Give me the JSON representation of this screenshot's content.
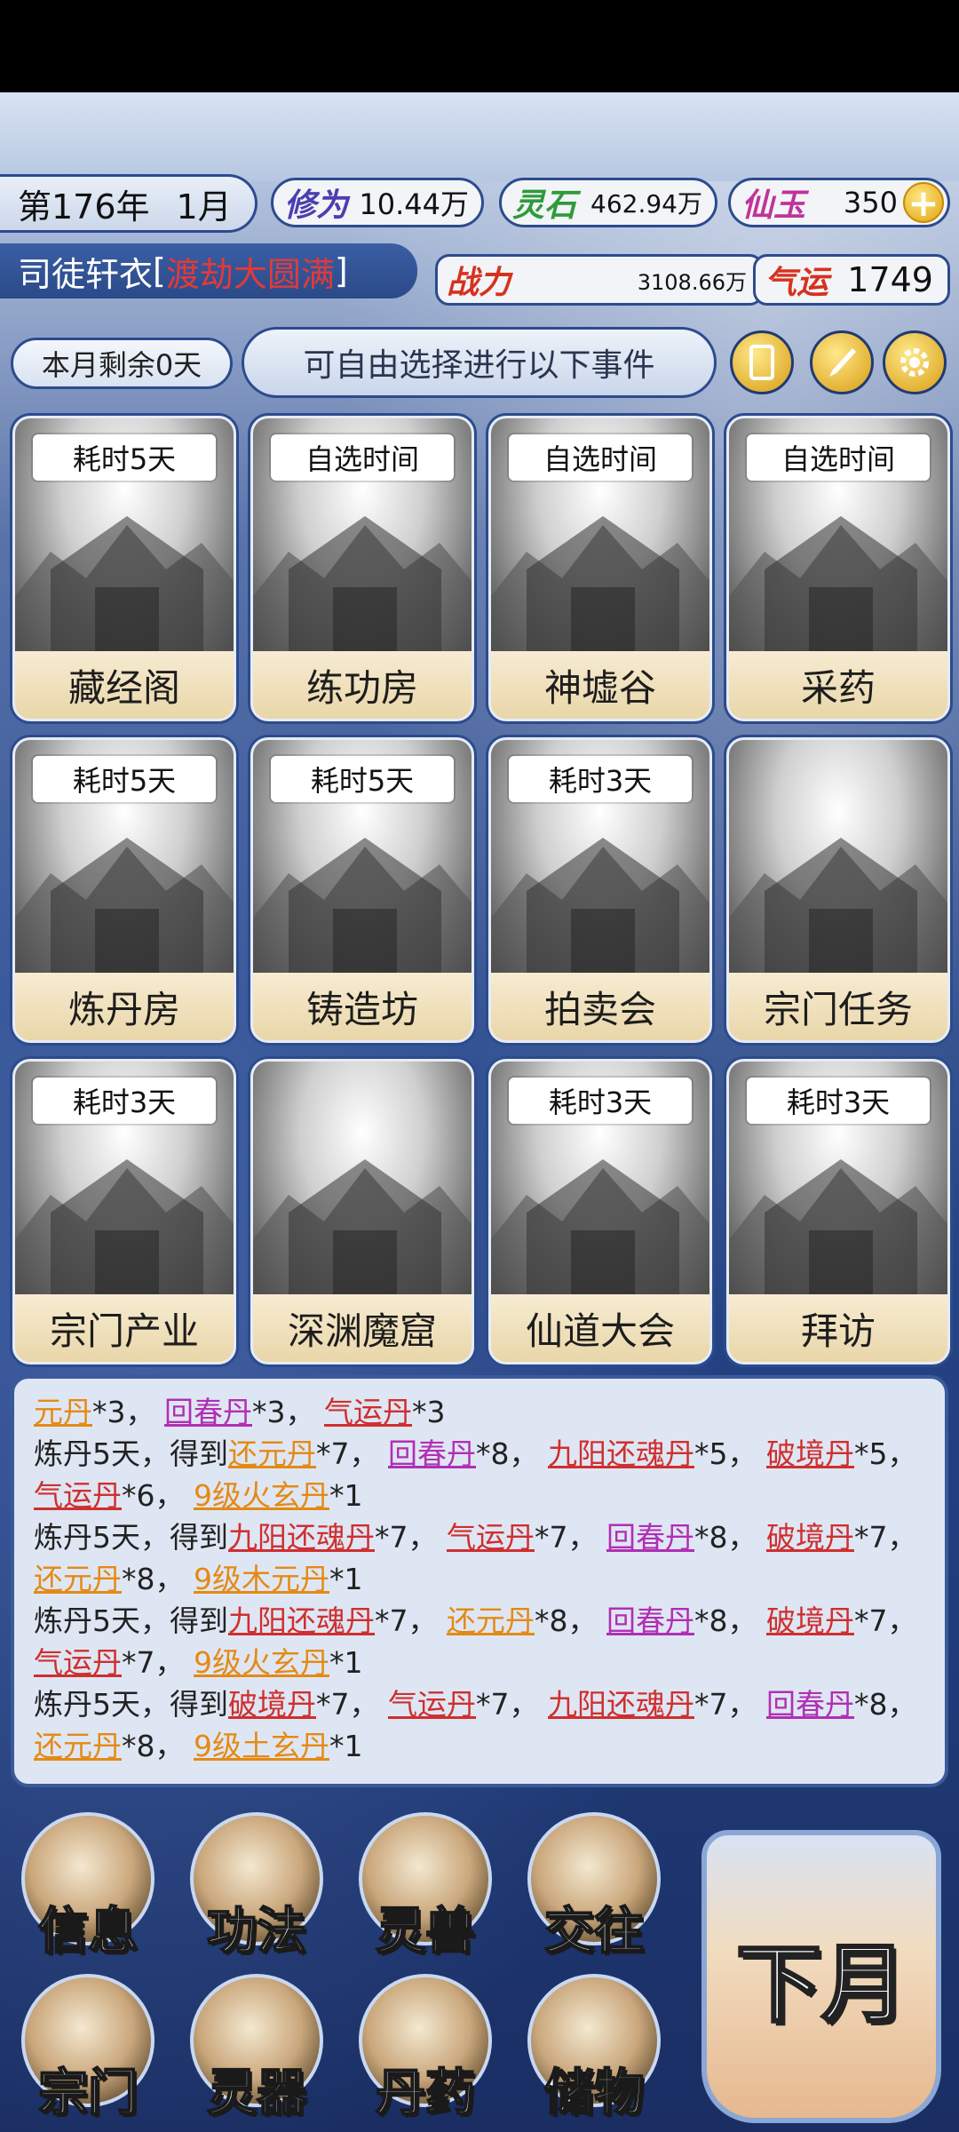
{
  "header": {
    "year": "第176年",
    "month": "1月",
    "xiuwei_label": "修为",
    "xiuwei_value": "10.44万",
    "lingshi_label": "灵石",
    "lingshi_value": "462.94万",
    "xianyu_label": "仙玉",
    "xianyu_value": "350",
    "plus": "+",
    "name": "司徒轩衣",
    "realm": "渡劫大圆满",
    "zhanli_label": "战力",
    "zhanli_value": "3108.66万",
    "qiyun_label": "气运",
    "qiyun_value": "1749",
    "days_left": "本月剩余0天",
    "prompt": "可自由选择进行以下事件"
  },
  "events": [
    {
      "time": "耗时5天",
      "label": "藏经阁"
    },
    {
      "time": "自选时间",
      "label": "练功房"
    },
    {
      "time": "自选时间",
      "label": "神墟谷"
    },
    {
      "time": "自选时间",
      "label": "采药"
    },
    {
      "time": "耗时5天",
      "label": "炼丹房"
    },
    {
      "time": "耗时5天",
      "label": "铸造坊"
    },
    {
      "time": "耗时3天",
      "label": "拍卖会"
    },
    {
      "time": "",
      "label": "宗门任务"
    },
    {
      "time": "耗时3天",
      "label": "宗门产业"
    },
    {
      "time": "",
      "label": "深渊魔窟"
    },
    {
      "time": "耗时3天",
      "label": "仙道大会"
    },
    {
      "time": "耗时3天",
      "label": "拜访"
    }
  ],
  "log": {
    "l0": {
      "a": "元丹",
      "b": "*3，",
      "c": "回春丹",
      "d": "*3，",
      "e": "气运丹",
      "f": "*3"
    },
    "l1": {
      "p": "炼丹5天，得到",
      "a": "还元丹",
      "b": "*7，",
      "c": "回春丹",
      "d": "*8，",
      "e": "九阳还魂丹",
      "f": "*5，",
      "g": "破境丹",
      "h": "*5，",
      "i": "气运丹",
      "j": "*6，",
      "k": "9级火玄丹",
      "l": "*1"
    },
    "l2": {
      "p": "炼丹5天，得到",
      "a": "九阳还魂丹",
      "b": "*7，",
      "c": "气运丹",
      "d": "*7，",
      "e": "回春丹",
      "f": "*8，",
      "g": "破境丹",
      "h": "*7，",
      "i": "还元丹",
      "j": "*8，",
      "k": "9级木元丹",
      "l": "*1"
    },
    "l3": {
      "p": "炼丹5天，得到",
      "a": "九阳还魂丹",
      "b": "*7，",
      "c": "还元丹",
      "d": "*8，",
      "e": "回春丹",
      "f": "*8，",
      "g": "破境丹",
      "h": "*7，",
      "i": "气运丹",
      "j": "*7，",
      "k": "9级火玄丹",
      "l": "*1"
    },
    "l4": {
      "p": "炼丹5天，得到",
      "a": "破境丹",
      "b": "*7，",
      "c": "气运丹",
      "d": "*7，",
      "e": "九阳还魂丹",
      "f": "*7，",
      "g": "回春丹",
      "h": "*8，",
      "i": "还元丹",
      "j": "*8，",
      "k": "9级土玄丹",
      "l": "*1"
    }
  },
  "menu": {
    "info": "信息",
    "gongfa": "功法",
    "lingshou": "灵兽",
    "jiaowang": "交往",
    "zongmen": "宗门",
    "lingqi": "灵器",
    "danyao": "丹药",
    "chuwu": "储物",
    "next_month": "下月"
  },
  "colors": {
    "orange_item": "#e48a14",
    "purple_item": "#b02fb5",
    "red_item": "#cf2f2f",
    "realm": "#e23a3a",
    "frame_blue": "#2c4b8e"
  }
}
